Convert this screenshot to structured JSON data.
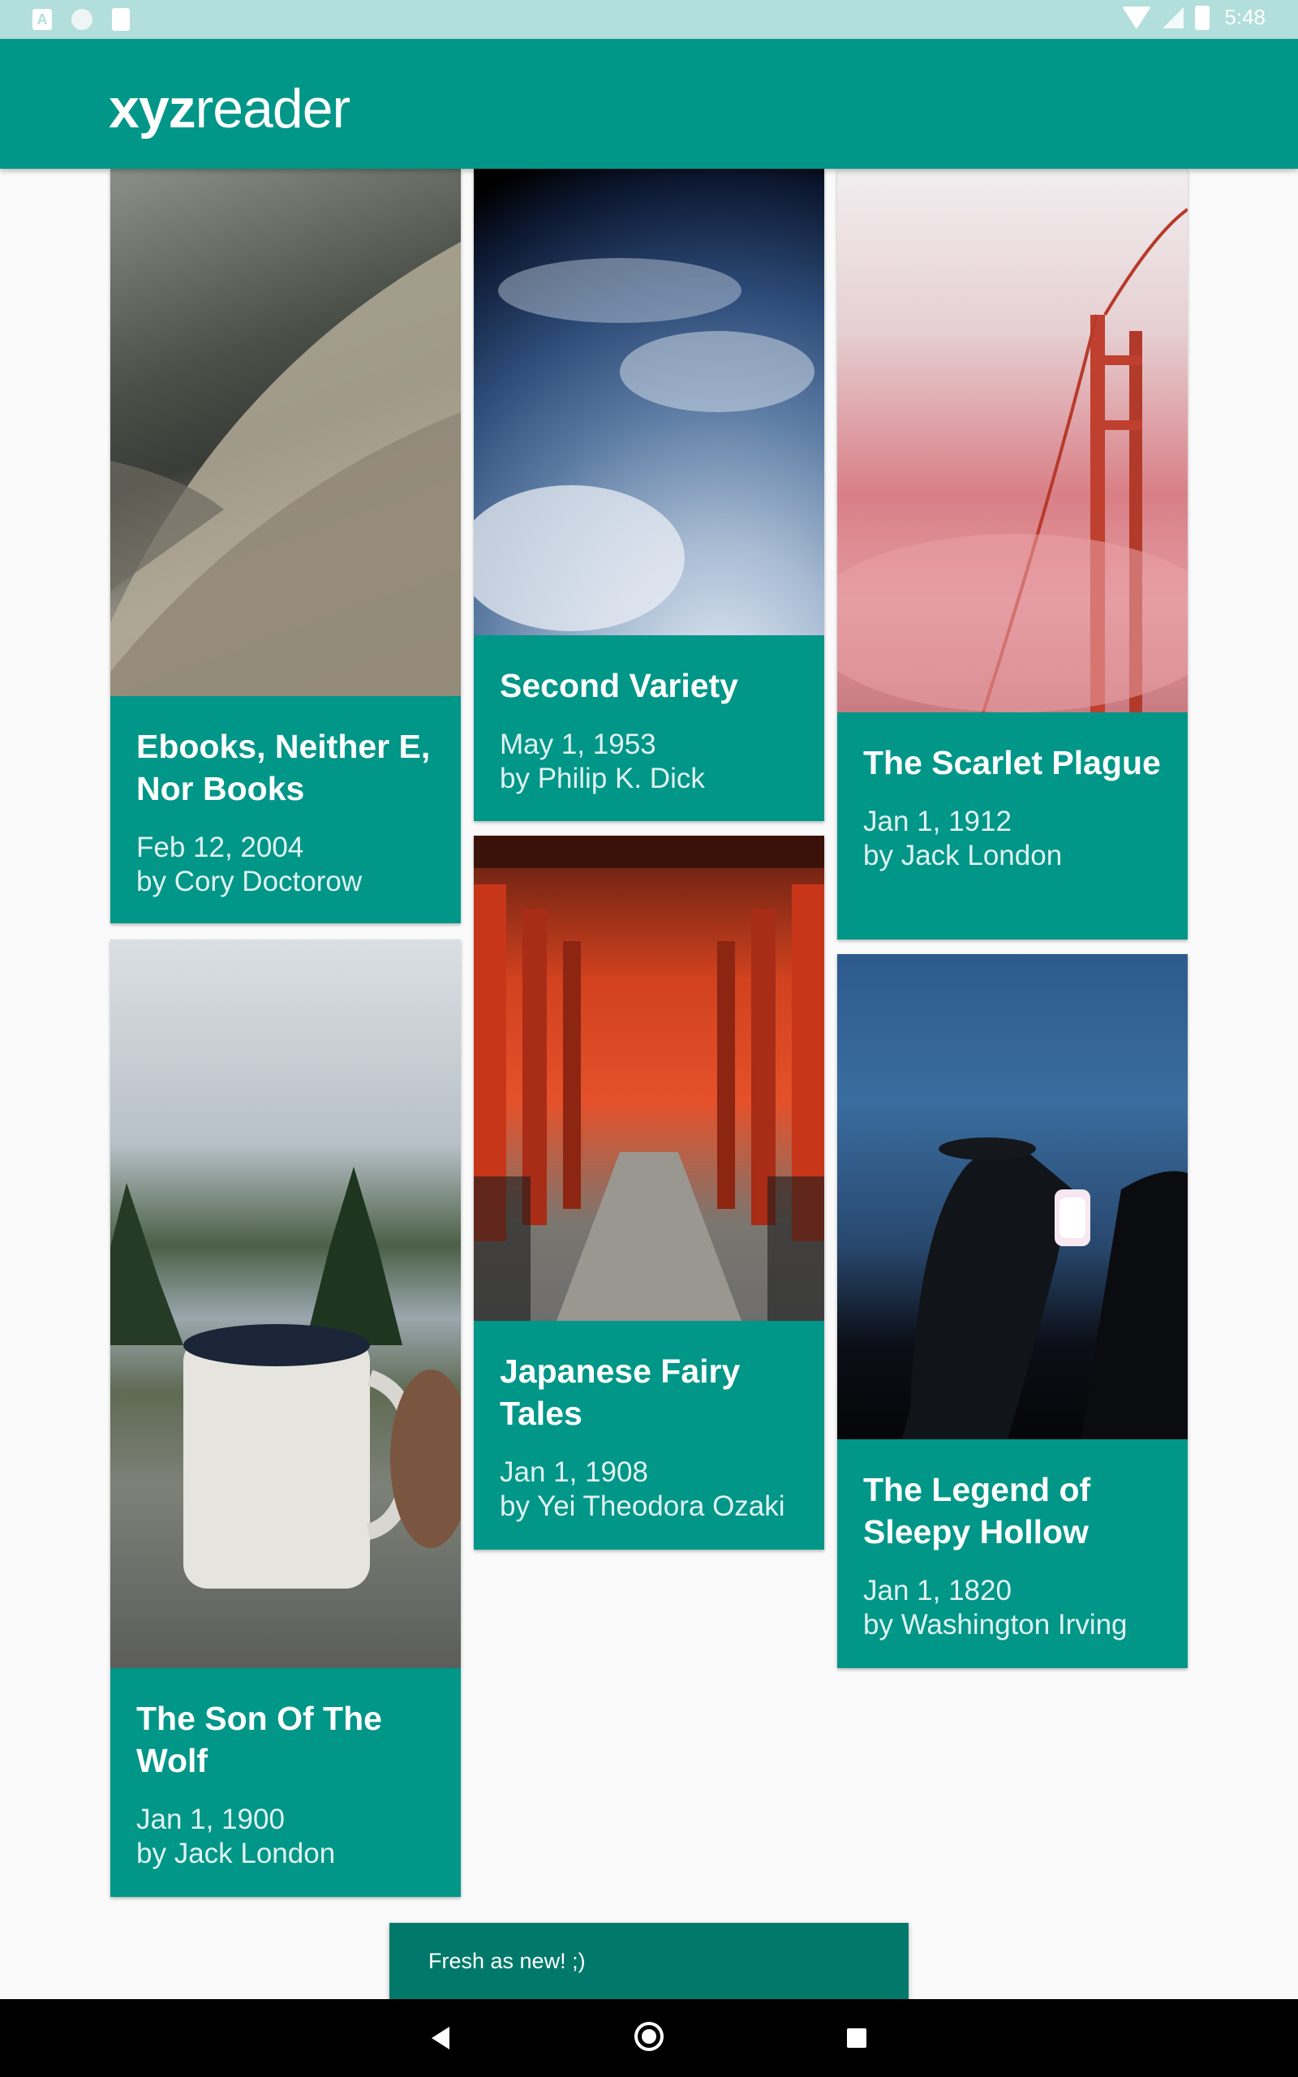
{
  "status_bar": {
    "time": "5:48",
    "icons": [
      "app-a-icon",
      "circle-icon",
      "sd-card-icon",
      "wifi-icon",
      "signal-icon",
      "battery-icon"
    ]
  },
  "app_bar": {
    "logo_bold": "xyz",
    "logo_regular": "reader"
  },
  "articles": [
    {
      "title": "Ebooks, Neither E, Nor Books",
      "date": "Feb 12, 2004",
      "author": "by Cory Doctorow"
    },
    {
      "title": "Second Variety",
      "date": "May 1, 1953",
      "author": "by Philip K. Dick"
    },
    {
      "title": "The Scarlet Plague",
      "date": "Jan 1, 1912",
      "author": "by Jack London"
    },
    {
      "title": "The Son Of The Wolf",
      "date": "Jan 1, 1900",
      "author": "by Jack London"
    },
    {
      "title": "Japanese Fairy Tales",
      "date": "Jan 1, 1908",
      "author": "by Yei Theodora Ozaki"
    },
    {
      "title": "The Legend of Sleepy Hollow",
      "date": "Jan 1, 1820",
      "author": "by Washington Irving"
    }
  ],
  "snackbar": {
    "message": "Fresh as new! ;)"
  },
  "colors": {
    "primary": "#009688",
    "primary_dark": "#00796b",
    "status_bar": "#b2dfdb"
  }
}
